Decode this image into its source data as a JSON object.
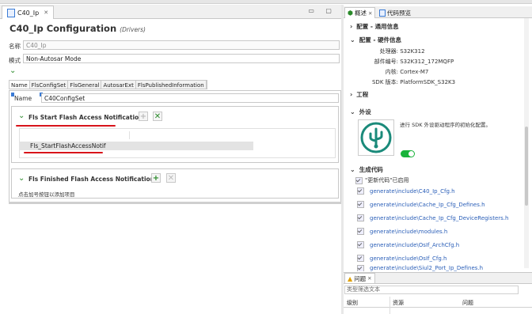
{
  "editor": {
    "tab_label": "C40_Ip",
    "tab_close": "✕",
    "window_controls": "▭ ▢",
    "title": "C40_Ip Configuration",
    "title_suffix": "(Drivers)",
    "name_label": "名称",
    "name_value": "C40_Ip",
    "mode_label": "模式",
    "mode_value": "Non-Autosar Mode",
    "subtabs": [
      "Name",
      "FlsConfigSet",
      "FlsGeneral",
      "AutosarExt",
      "FlsPublishedInformation"
    ],
    "config_name_label": "Name",
    "config_name_value": "C40ConfigSet",
    "start_section": {
      "title": "Fls Start Flash Access Notification",
      "selected_item": "Fls_StartFlashAccessNotif"
    },
    "finished_section": {
      "title": "Fls Finished Flash Access Notifications",
      "hint": "点击加号按钮以添加项目"
    }
  },
  "right_panel": {
    "tabs": [
      "概述",
      "代码预览"
    ],
    "overview_close": "✕",
    "sections": {
      "config_general": "配置 - 通用信息",
      "config_hardware": "配置 - 硬件信息",
      "project": "工程",
      "peripheral": "外设",
      "generated_code": "生成代码"
    },
    "hardware": [
      {
        "key": "处理器:",
        "value": "S32K312"
      },
      {
        "key": "部件编号:",
        "value": "S32K312_172MQFP"
      },
      {
        "key": "内核:",
        "value": "Cortex-M7"
      },
      {
        "key": "SDK 版本:",
        "value": "PlatformSDK_S32K3"
      }
    ],
    "peripheral_desc": "进行 SDK 外设驱动程序的初始化配置。",
    "update_code_label": "\"更新代码\"已启用",
    "generated_files": [
      "generate\\include\\C40_Ip_Cfg.h",
      "generate\\include\\Cache_Ip_Cfg_Defines.h",
      "generate\\include\\Cache_Ip_Cfg_DeviceRegisters.h",
      "generate\\include\\modules.h",
      "generate\\include\\OsIf_ArchCfg.h",
      "generate\\include\\OsIf_Cfg.h",
      "generate\\include\\Siul2_Port_Ip_Defines.h"
    ]
  },
  "problems": {
    "tab_label": "问题",
    "filter_placeholder": "类型筛选文本",
    "columns": [
      "级别",
      "资源",
      "问题"
    ]
  },
  "colors": {
    "accent_green": "#2a8a2a",
    "link_blue": "#2b5fb8",
    "annotation_red": "#d8141a",
    "toggle_on": "#19b33a"
  }
}
